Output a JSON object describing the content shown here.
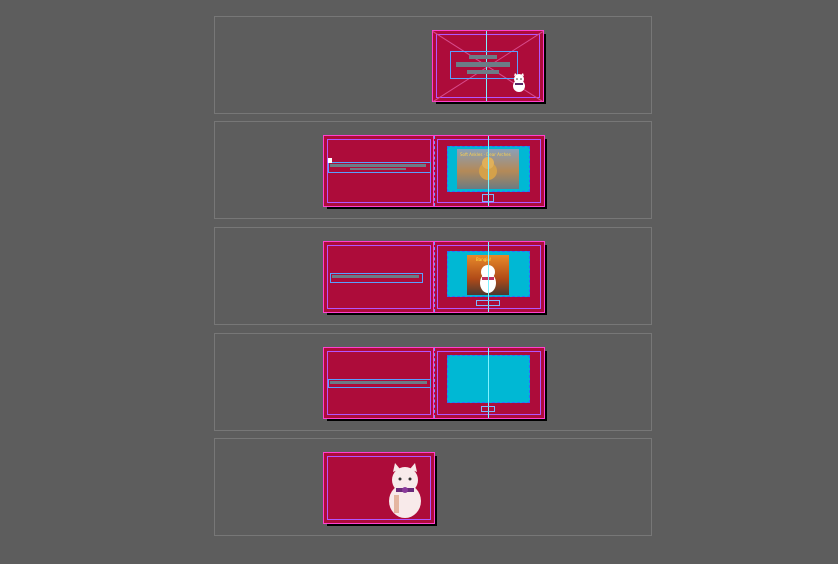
{
  "window": {
    "title": ""
  },
  "spreads": [
    {
      "index": 1,
      "pages": 1
    },
    {
      "index": 2,
      "pages": 2,
      "cover_caption": "Soft Ankles · Dear Arches"
    },
    {
      "index": 3,
      "pages": 2,
      "cover_caption": "Bangin!"
    },
    {
      "index": 4,
      "pages": 2
    },
    {
      "index": 5,
      "pages": 1
    }
  ],
  "colors": {
    "pasteboard": "#5d5d5d",
    "page_fill": "#ad0c3a",
    "page_border": "#ff40d0",
    "margin_guide": "#b256ff",
    "placeholder": "#00b8d4",
    "text_bar": "#6c7c86"
  },
  "icons": [
    "cat-illustration",
    "photo-thumbnail"
  ]
}
